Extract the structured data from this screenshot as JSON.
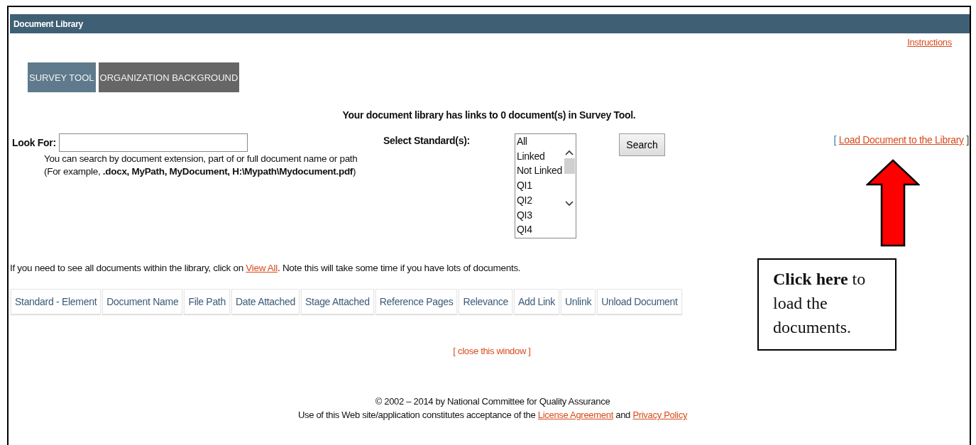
{
  "window": {
    "title": "Document Library"
  },
  "instructions_link": "Instructions",
  "tabs": [
    {
      "label": "SURVEY TOOL",
      "selected": true
    },
    {
      "label": "ORGANIZATION BACKGROUND",
      "selected": false
    }
  ],
  "summary": "Your document library has links to 0 document(s) in Survey Tool.",
  "search": {
    "label": "Look For:",
    "hint_lines": [
      "You can search by document extension, part of or full document name or path",
      "(For example, **.docx, MyPath, MyDocument, H:\\Mypath\\Mydocument.pdf**)"
    ]
  },
  "standards": {
    "label": "Select Standard(s):",
    "options": [
      {
        "label": "All",
        "selected": false
      },
      {
        "label": "Linked",
        "selected": false
      },
      {
        "label": "Not Linked",
        "selected": false
      },
      {
        "label": "QI1",
        "selected": false
      },
      {
        "label": "QI2",
        "selected": false
      },
      {
        "label": "QI3",
        "selected": false
      },
      {
        "label": "QI4",
        "selected": false
      }
    ]
  },
  "search_button": "Search",
  "load_link": {
    "open": "[",
    "label": "Load Document to the Library",
    "close": "]"
  },
  "note": [
    {
      "kind": "text",
      "text": "If you need to see all documents within the library, click on "
    },
    {
      "kind": "link",
      "text": "View All"
    },
    {
      "kind": "text",
      "text": ". Note this will take some time if you have lots of documents."
    }
  ],
  "table": {
    "columns": [
      "Standard - Element",
      "Document Name",
      "File Path",
      "Date Attached",
      "Stage Attached",
      "Reference Pages",
      "Relevance",
      "Add Link",
      "Unlink",
      "Unload Document"
    ]
  },
  "close_link": "[ close this window ]",
  "footer": {
    "copyright": "© 2002 – 2014 by National Committee for Quality Assurance",
    "terms": [
      {
        "kind": "text",
        "text": "Use of this Web site/application constitutes acceptance of the "
      },
      {
        "kind": "link",
        "text": "License Agreement"
      },
      {
        "kind": "text",
        "text": " and "
      },
      {
        "kind": "link",
        "text": "Privacy Policy"
      }
    ]
  },
  "callout": {
    "text": "**Click here** to load the documents."
  }
}
